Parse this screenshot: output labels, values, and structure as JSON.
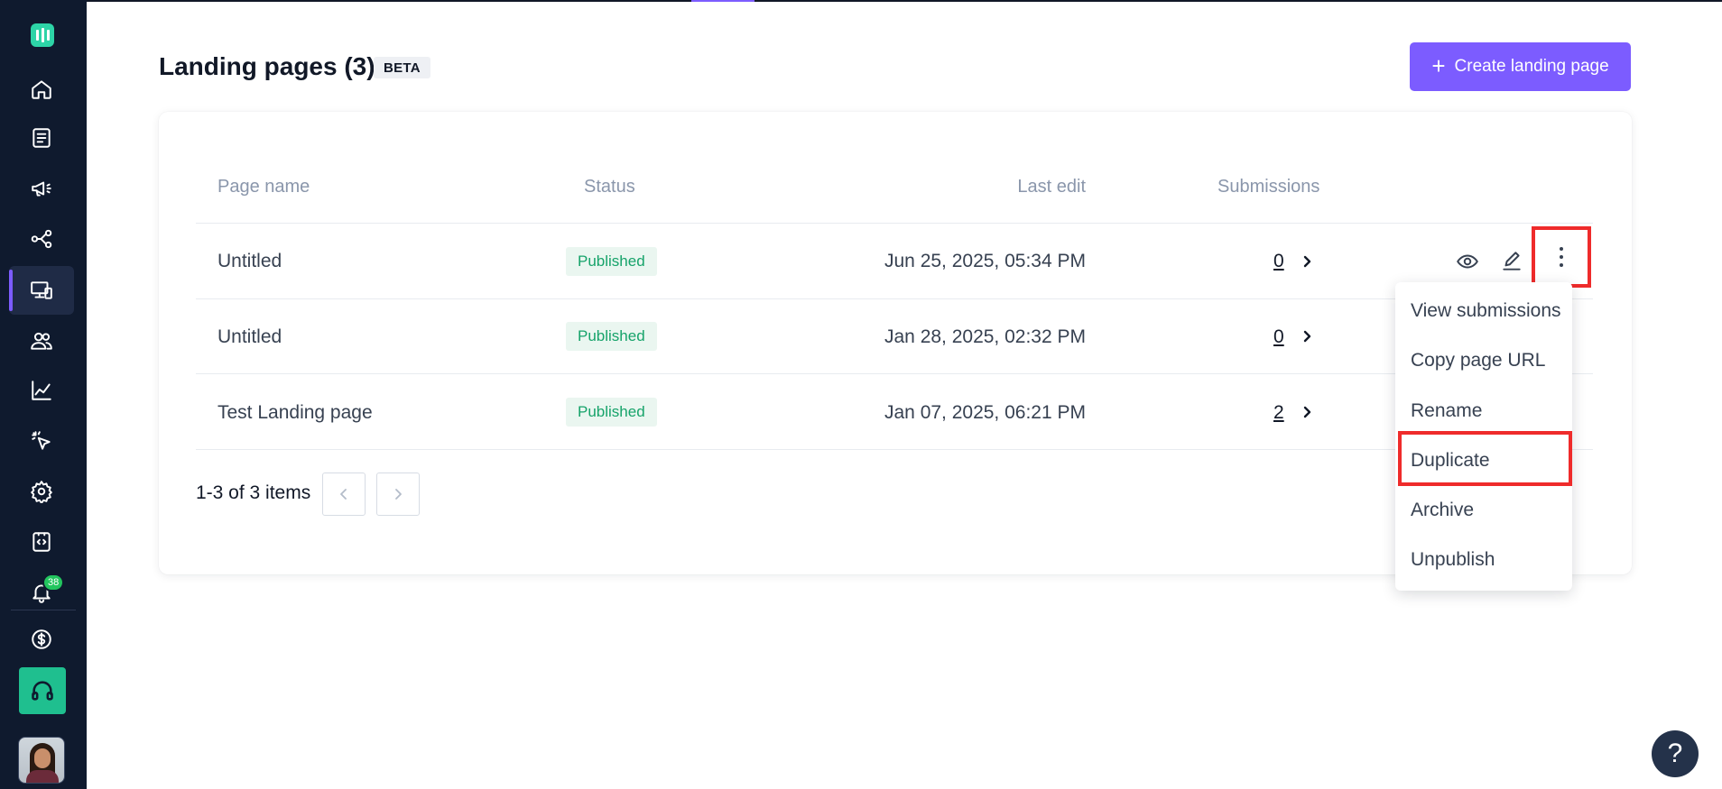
{
  "page": {
    "title": "Landing pages (3)",
    "badge": "BETA",
    "create_label": "Create landing page"
  },
  "sidebar": {
    "items": [
      {
        "name": "home",
        "icon": "home-icon"
      },
      {
        "name": "forms",
        "icon": "document-icon"
      },
      {
        "name": "campaigns",
        "icon": "megaphone-icon"
      },
      {
        "name": "flows",
        "icon": "workflow-icon"
      },
      {
        "name": "landing-pages",
        "icon": "devices-icon",
        "active": true
      },
      {
        "name": "audience",
        "icon": "users-icon"
      },
      {
        "name": "analytics",
        "icon": "chart-line-icon"
      },
      {
        "name": "tracking",
        "icon": "cursor-click-icon"
      },
      {
        "name": "settings",
        "icon": "gear-icon"
      },
      {
        "name": "integrations",
        "icon": "code-icon"
      },
      {
        "name": "notifications",
        "icon": "bell-icon"
      },
      {
        "name": "billing",
        "icon": "dollar-icon"
      }
    ],
    "notification_count": "38",
    "support_icon": "headset-icon"
  },
  "table": {
    "columns": [
      "Page name",
      "Status",
      "Last edit",
      "Submissions"
    ],
    "rows": [
      {
        "name": "Untitled",
        "status": "Published",
        "last_edit": "Jun 25, 2025, 05:34 PM",
        "submissions": "0"
      },
      {
        "name": "Untitled",
        "status": "Published",
        "last_edit": "Jan 28, 2025, 02:32 PM",
        "submissions": "0"
      },
      {
        "name": "Test Landing page",
        "status": "Published",
        "last_edit": "Jan 07, 2025, 06:21 PM",
        "submissions": "2"
      }
    ]
  },
  "pagination": {
    "summary": "1-3 of 3 items"
  },
  "menu": {
    "items": [
      "View submissions",
      "Copy page URL",
      "Rename",
      "Duplicate",
      "Archive",
      "Unpublish"
    ],
    "highlighted": "Duplicate"
  },
  "help": {
    "label": "?"
  },
  "colors": {
    "accent": "#7c5cff",
    "sidebar_bg": "#0f1a2e",
    "status_text": "#16a36a",
    "status_bg": "#eaf6f0",
    "highlight": "#ef2b2b",
    "support": "#1fbf8f"
  }
}
